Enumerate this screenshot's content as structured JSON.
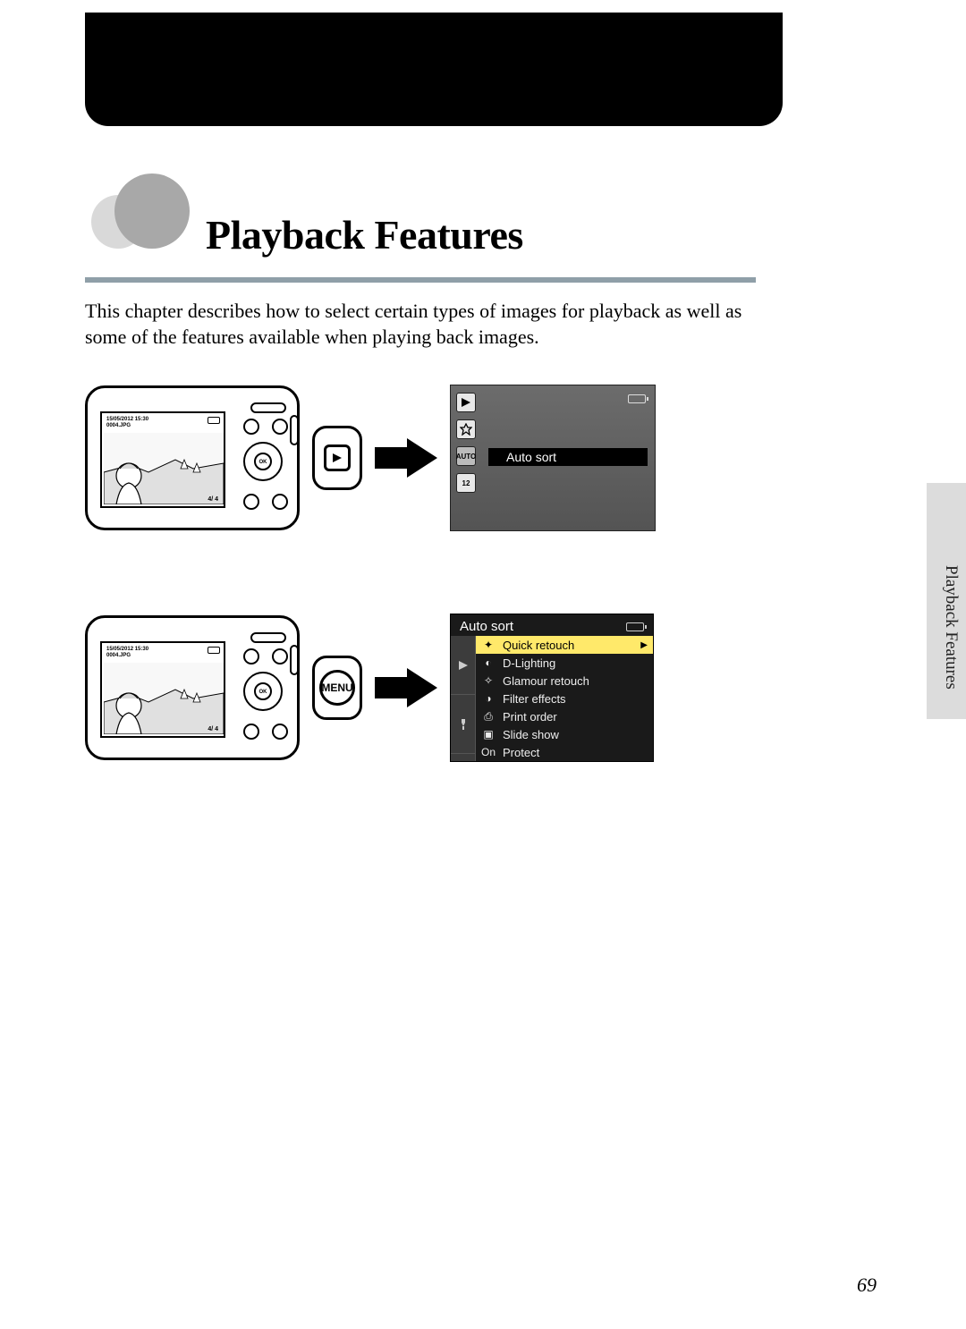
{
  "chapter": {
    "title": "Playback Features",
    "intro": "This chapter describes how to select certain types of images for playback as well as some of the features available when playing back images."
  },
  "side_tab": "Playback Features",
  "camera_lcd": {
    "date": "15/05/2012 15:30",
    "filename": "0004.JPG",
    "counter": "4/ 4",
    "ok_label": "OK"
  },
  "callout_buttons": {
    "play_icon": "play",
    "menu_label": "MENU"
  },
  "playback_mode_screen": {
    "selected_label": "Auto sort",
    "icon_ids": [
      "play",
      "star",
      "auto",
      "date"
    ],
    "auto_text": "AUTO",
    "date_text": "12"
  },
  "playback_menu_screen": {
    "title": "Auto sort",
    "items": [
      {
        "icon_id": "retouch",
        "label": "Quick retouch",
        "selected": true
      },
      {
        "icon_id": "dlight",
        "label": "D-Lighting",
        "selected": false
      },
      {
        "icon_id": "glamour",
        "label": "Glamour retouch",
        "selected": false
      },
      {
        "icon_id": "filter",
        "label": "Filter effects",
        "selected": false
      },
      {
        "icon_id": "print",
        "label": "Print order",
        "selected": false
      },
      {
        "icon_id": "slide",
        "label": "Slide show",
        "selected": false
      },
      {
        "icon_id": "protect",
        "label": "Protect",
        "selected": false
      }
    ],
    "protect_icon_text": "On"
  },
  "page_number": "69"
}
